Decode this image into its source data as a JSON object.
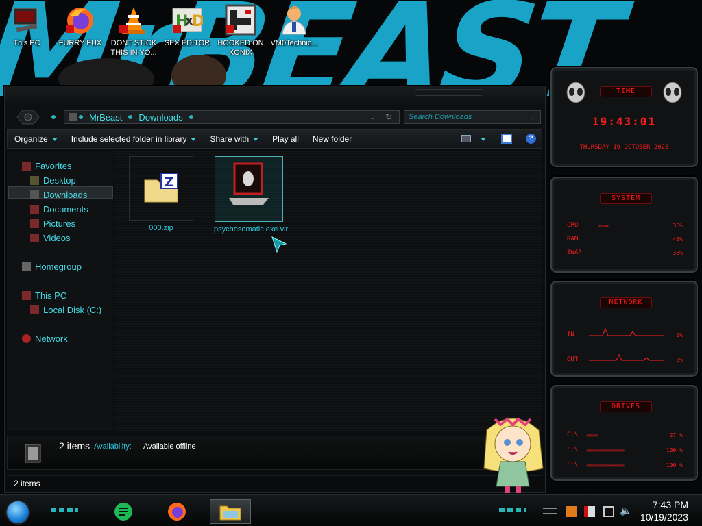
{
  "desktop": {
    "icons": [
      {
        "label": "This PC"
      },
      {
        "label": "FURRY FUX"
      },
      {
        "label": "DONT STICK THIS IN YO..."
      },
      {
        "label": "SEX EDITOR"
      },
      {
        "label": "HOOKED ON XONIX"
      },
      {
        "label": "VM0Technic..."
      }
    ]
  },
  "explorer": {
    "breadcrumb": [
      "MrBeast",
      "Downloads"
    ],
    "search_placeholder": "Search Downloads",
    "toolbar": {
      "organize": "Organize",
      "include": "Include selected folder in library",
      "share": "Share with",
      "play": "Play all",
      "new_folder": "New folder"
    },
    "sidebar": {
      "favorites": "Favorites",
      "desktop": "Desktop",
      "downloads": "Downloads",
      "documents": "Documents",
      "pictures": "Pictures",
      "videos": "Videos",
      "homegroup": "Homegroup",
      "this_pc": "This PC",
      "local_disk": "Local Disk (C:)",
      "network": "Network"
    },
    "files": [
      {
        "name": "000.zip"
      },
      {
        "name": "psychosomatic.exe.vir"
      }
    ],
    "details": {
      "count": "2 items",
      "availability_label": "Availability:",
      "availability_value": "Available offline"
    },
    "status": "2 items"
  },
  "gadgets": {
    "time": {
      "title": "TIME",
      "clock": "19:43:01",
      "date": "THURSDAY 19 OCTOBER 2023"
    },
    "system": {
      "title": "SYSTEM",
      "rows": [
        {
          "label": "CPU",
          "value": "36%"
        },
        {
          "label": "RAM",
          "value": "48%"
        },
        {
          "label": "SWAP",
          "value": "36%"
        }
      ]
    },
    "network": {
      "title": "NETWORK",
      "rows": [
        {
          "label": "IN",
          "value": "0%"
        },
        {
          "label": "OUT",
          "value": "0%"
        }
      ]
    },
    "drives": {
      "title": "DRIVES",
      "rows": [
        {
          "label": "C:\\",
          "value": "27 %"
        },
        {
          "label": "F:\\",
          "value": "100 %"
        },
        {
          "label": "E:\\",
          "value": "100 %"
        }
      ]
    }
  },
  "taskbar": {
    "time": "7:43 PM",
    "date": "10/19/2023"
  },
  "colors": {
    "accent_cyan": "#3ee0e6",
    "gadget_red": "#ff1d1d",
    "wallpaper_blue": "#19a3c7"
  }
}
